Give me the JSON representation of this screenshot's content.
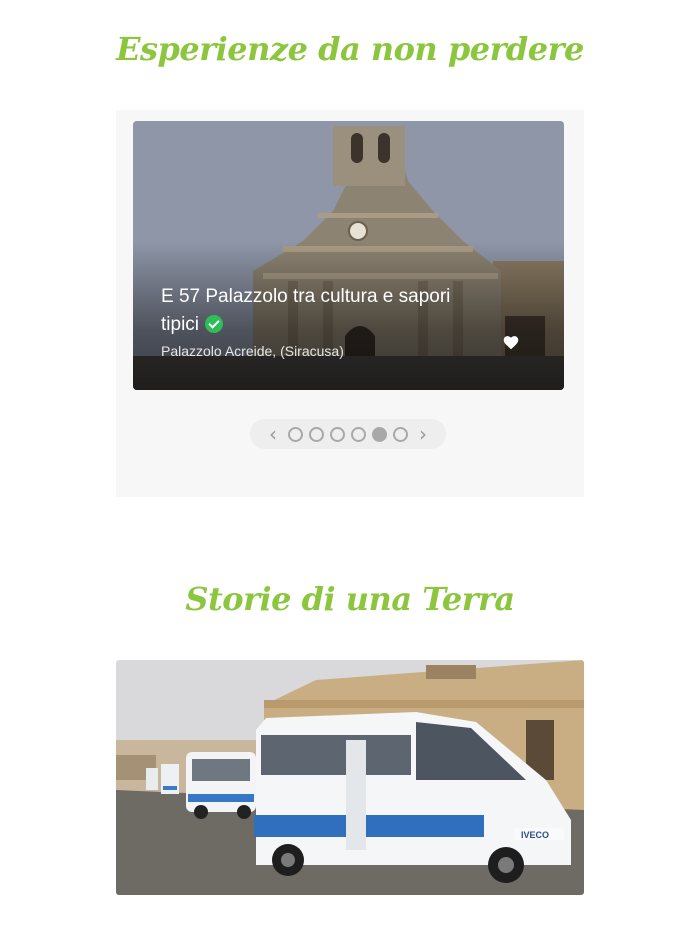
{
  "sections": {
    "experiences_title": "Esperienze da non perdere",
    "stories_title": "Storie di una Terra"
  },
  "card": {
    "title": "E 57 Palazzolo tra cultura e sapori tipici",
    "location": "Palazzolo Acreide, (Siracusa)",
    "image": "church-facade",
    "verified_icon": "check-circle-icon",
    "favorite_icon": "heart-icon"
  },
  "pager": {
    "prev_icon": "chevron-left-icon",
    "next_icon": "chevron-right-icon",
    "prev": "‹",
    "next": "›",
    "dots": 6,
    "active_dot": 5
  },
  "story": {
    "image": "minibus-street",
    "bus_logo": "IVECO"
  },
  "colors": {
    "title_green": "#8cc63f",
    "verified_green": "#2ebd59",
    "panel_bg": "#f7f7f7"
  }
}
